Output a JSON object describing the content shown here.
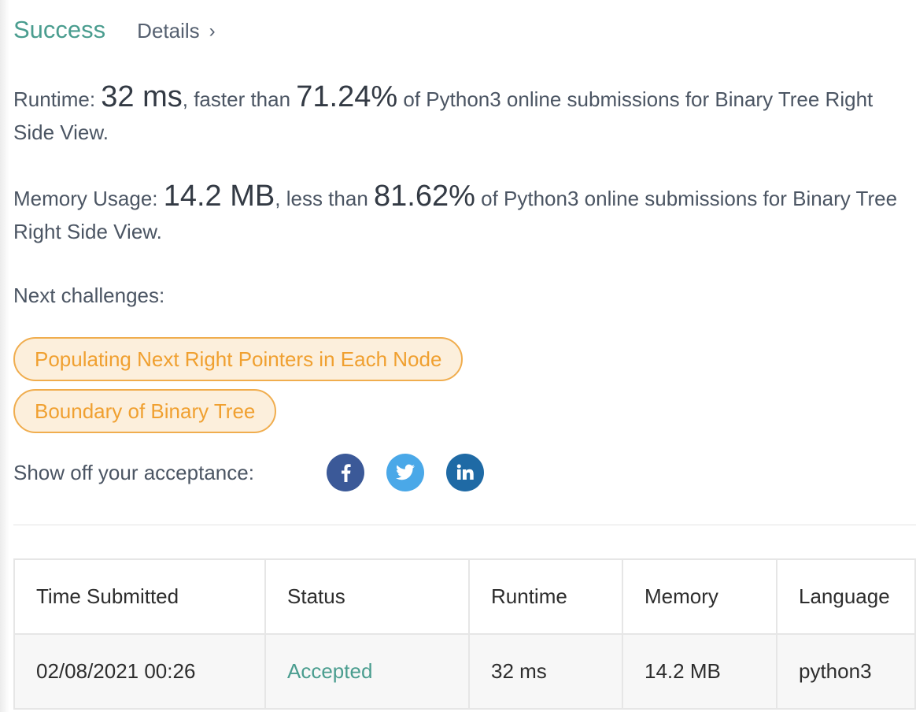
{
  "header": {
    "status": "Success",
    "details_link": "Details",
    "details_chevron": "›"
  },
  "runtime": {
    "label": "Runtime: ",
    "value": "32 ms",
    "comparison": ", faster than ",
    "percent": "71.24%",
    "suffix": " of Python3 online submissions for Binary Tree Right Side View."
  },
  "memory": {
    "label": "Memory Usage: ",
    "value": "14.2 MB",
    "comparison": ", less than ",
    "percent": "81.62%",
    "suffix": " of Python3 online submissions for Binary Tree Right Side View."
  },
  "next": {
    "label": "Next challenges:",
    "challenges": [
      "Populating Next Right Pointers in Each Node",
      "Boundary of Binary Tree"
    ]
  },
  "share": {
    "label": "Show off your acceptance:",
    "icons": [
      "facebook-icon",
      "twitter-icon",
      "linkedin-icon"
    ]
  },
  "submissions": {
    "columns": [
      "Time Submitted",
      "Status",
      "Runtime",
      "Memory",
      "Language"
    ],
    "rows": [
      [
        "02/08/2021 00:26",
        "Accepted",
        "32 ms",
        "14.2 MB",
        "python3"
      ]
    ]
  },
  "colors": {
    "success": "#4a9d8f",
    "chip_border": "#f0ad4e",
    "chip_bg": "#fcefdc",
    "facebook": "#3b5998",
    "twitter": "#4aa8e8",
    "linkedin": "#1f6aa5"
  }
}
